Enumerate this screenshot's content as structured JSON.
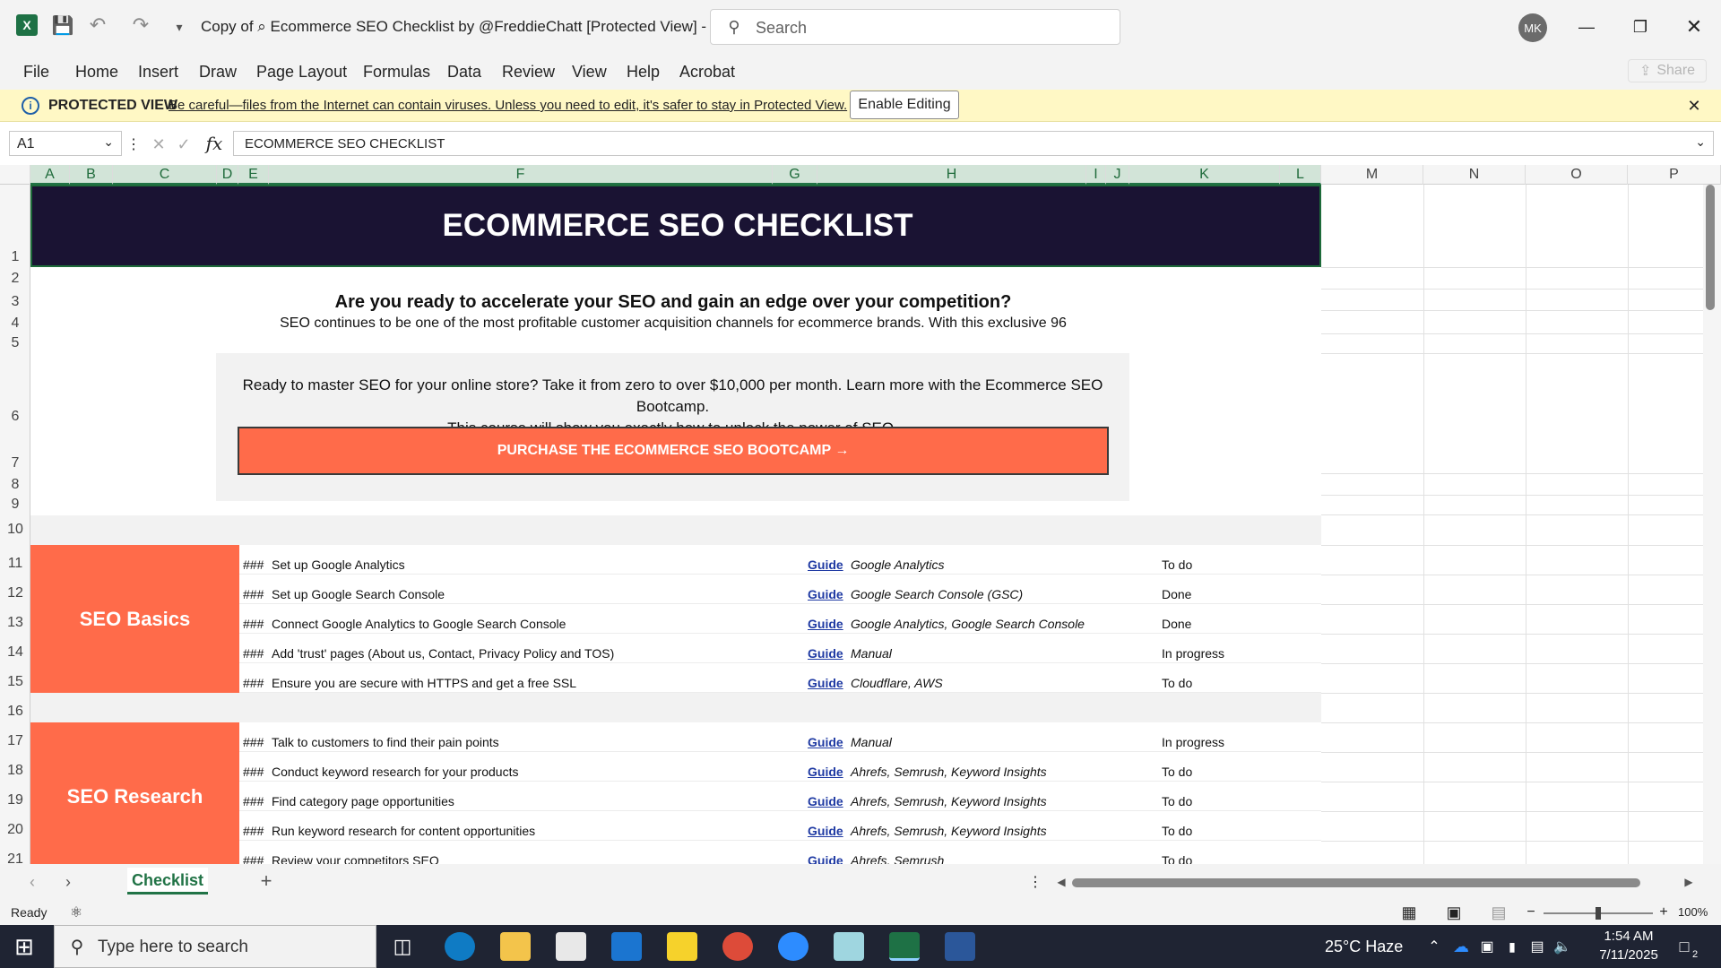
{
  "window": {
    "title": "Copy of ⌕ Ecommerce SEO Checklist by @FreddieChatt  [Protected View]  -  E...",
    "search_placeholder": "Search",
    "user_initials": "MK"
  },
  "menu": [
    "File",
    "Home",
    "Insert",
    "Draw",
    "Page Layout",
    "Formulas",
    "Data",
    "Review",
    "View",
    "Help",
    "Acrobat"
  ],
  "share_label": "Share",
  "protected_view": {
    "title": "PROTECTED VIEW",
    "message": "Be careful—files from the Internet can contain viruses. Unless you need to edit, it's safer to stay in Protected View.",
    "button": "Enable Editing"
  },
  "formula_bar": {
    "cell_ref": "A1",
    "content": "ECOMMERCE SEO CHECKLIST"
  },
  "columns": [
    "A",
    "B",
    "C",
    "D",
    "E",
    "F",
    "G",
    "H",
    "I",
    "J",
    "K",
    "L",
    "M",
    "N",
    "O",
    "P"
  ],
  "rows": [
    "1",
    "2",
    "3",
    "4",
    "5",
    "6",
    "7",
    "8",
    "9",
    "10",
    "11",
    "12",
    "13",
    "14",
    "15",
    "16",
    "17",
    "18",
    "19",
    "20",
    "21"
  ],
  "sheet": {
    "banner": "ECOMMERCE SEO CHECKLIST",
    "headline": "Are you ready to accelerate your SEO and gain an edge over your competition?",
    "subline": "SEO continues to be one of the most profitable customer acquisition channels for ecommerce brands. With this exclusive 96",
    "promo_line1": "Ready to master SEO for your online store? Take it from zero to over $10,000 per month. Learn more with the Ecommerce SEO Bootcamp.",
    "promo_line2": "This course will show you exactly how to unlock the power of SEO.",
    "cta": "PURCHASE THE ECOMMERCE SEO BOOTCAMP →",
    "sections": [
      {
        "category": "SEO Basics",
        "tasks": [
          {
            "num": "###",
            "task": "Set up Google Analytics",
            "guide": "Guide",
            "tools": "Google Analytics",
            "status": "To do"
          },
          {
            "num": "###",
            "task": "Set up Google Search Console",
            "guide": "Guide",
            "tools": "Google Search Console (GSC)",
            "status": "Done"
          },
          {
            "num": "###",
            "task": "Connect Google Analytics to Google Search Console",
            "guide": "Guide",
            "tools": "Google Analytics, Google Search Console",
            "status": "Done"
          },
          {
            "num": "###",
            "task": "Add 'trust' pages (About us, Contact, Privacy Policy and TOS)",
            "guide": "Guide",
            "tools": "Manual",
            "status": "In progress"
          },
          {
            "num": "###",
            "task": "Ensure you are secure with HTTPS and get a free SSL",
            "guide": "Guide",
            "tools": "Cloudflare, AWS",
            "status": "To do"
          }
        ]
      },
      {
        "category": "SEO Research",
        "tasks": [
          {
            "num": "###",
            "task": "Talk to customers to find their pain points",
            "guide": "Guide",
            "tools": "Manual",
            "status": "In progress"
          },
          {
            "num": "###",
            "task": "Conduct keyword research for your products",
            "guide": "Guide",
            "tools": "Ahrefs, Semrush, Keyword Insights",
            "status": "To do"
          },
          {
            "num": "###",
            "task": "Find category page opportunities",
            "guide": "Guide",
            "tools": "Ahrefs, Semrush, Keyword Insights",
            "status": "To do"
          },
          {
            "num": "###",
            "task": "Run keyword research for content opportunities",
            "guide": "Guide",
            "tools": "Ahrefs, Semrush, Keyword Insights",
            "status": "To do"
          },
          {
            "num": "###",
            "task": "Review your competitors SEO",
            "guide": "Guide",
            "tools": "Ahrefs, Semrush",
            "status": "To do"
          }
        ]
      }
    ]
  },
  "sheet_tab": "Checklist",
  "status": {
    "ready": "Ready",
    "zoom": "100%"
  },
  "taskbar": {
    "search_placeholder": "Type here to search",
    "weather": "25°C  Haze",
    "time": "1:54 AM",
    "date": "7/11/2025",
    "notification_count": "2"
  },
  "colors": {
    "accent": "#217346",
    "banner": "#1a1333",
    "orange": "#ff6b4a",
    "pv_bar": "#fff8c5"
  }
}
